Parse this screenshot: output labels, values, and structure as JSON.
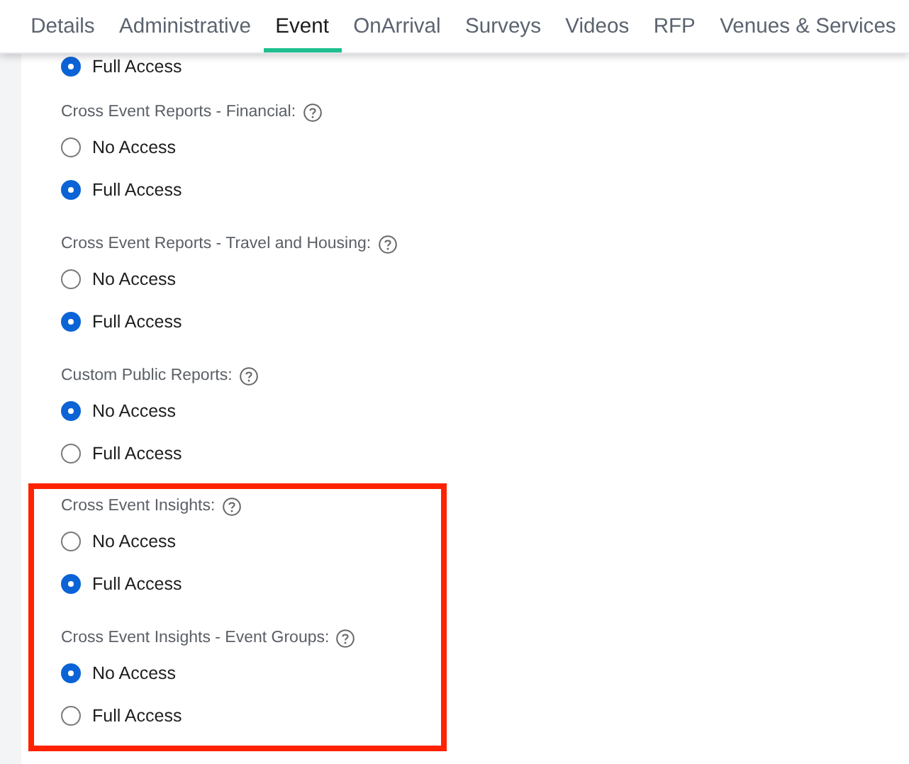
{
  "tabs": [
    {
      "label": "Details",
      "selected": false
    },
    {
      "label": "Administrative",
      "selected": false
    },
    {
      "label": "Event",
      "selected": true
    },
    {
      "label": "OnArrival",
      "selected": false
    },
    {
      "label": "Surveys",
      "selected": false
    },
    {
      "label": "Videos",
      "selected": false
    },
    {
      "label": "RFP",
      "selected": false
    },
    {
      "label": "Venues & Services",
      "selected": false
    }
  ],
  "groups": [
    {
      "options": [
        {
          "label": "Full Access",
          "selected": true
        }
      ]
    },
    {
      "label": "Cross Event Reports - Financial:",
      "options": [
        {
          "label": "No Access",
          "selected": false
        },
        {
          "label": "Full Access",
          "selected": true
        }
      ]
    },
    {
      "label": "Cross Event Reports - Travel and Housing:",
      "options": [
        {
          "label": "No Access",
          "selected": false
        },
        {
          "label": "Full Access",
          "selected": true
        }
      ]
    },
    {
      "label": "Custom Public Reports:",
      "options": [
        {
          "label": "No Access",
          "selected": true
        },
        {
          "label": "Full Access",
          "selected": false
        }
      ]
    }
  ],
  "highlighted_groups": [
    {
      "label": "Cross Event Insights:",
      "options": [
        {
          "label": "No Access",
          "selected": false
        },
        {
          "label": "Full Access",
          "selected": true
        }
      ]
    },
    {
      "label": "Cross Event Insights - Event Groups:",
      "options": [
        {
          "label": "No Access",
          "selected": true
        },
        {
          "label": "Full Access",
          "selected": false
        }
      ]
    }
  ]
}
